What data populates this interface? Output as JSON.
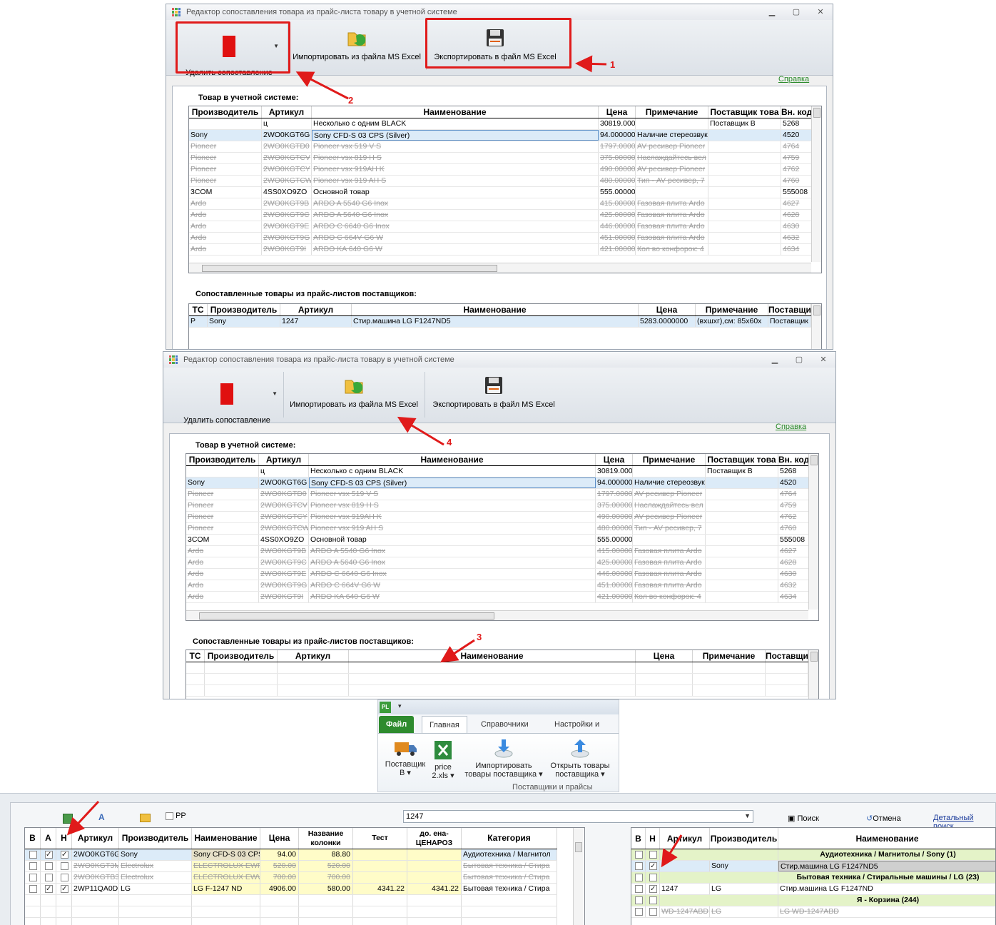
{
  "editor": {
    "title": "Редактор сопоставления товара из прайс-листа товару в учетной системе",
    "win_min": "▁",
    "win_max": "▢",
    "win_close": "✕",
    "delete_label": "Удалить сопоставление",
    "import_label": "Импортировать из файла MS Excel",
    "export_label": "Экспортировать в файл MS Excel",
    "help_label": "Справка",
    "accounting_label": "Товар в учетной системе:",
    "matched_label": "Сопоставленные товары из прайс-листов поставщиков:",
    "columns": [
      "Производитель",
      "Артикул",
      "Наименование",
      "Цена",
      "Примечание",
      "Поставщик това",
      "Вн. код"
    ],
    "rows": [
      {
        "maker": "",
        "sku": "ц",
        "name": "Несколько с одним BLACK",
        "price": "30819.000",
        "note": "",
        "supplier": "Поставщик В",
        "code": "5268",
        "state": "normal"
      },
      {
        "maker": "Sony",
        "sku": "2WO0KGT6G",
        "name": "Sony CFD-S 03 CPS (Silver)",
        "price": "94.000000",
        "note": "Наличие стереозвук",
        "supplier": "",
        "code": "4520",
        "state": "selected"
      },
      {
        "maker": "Pioneer",
        "sku": "2WO0KGTD0",
        "name": "Pioneer vsx 519 V S",
        "price": "1797.0000",
        "note": "AV ресивер Pioneer",
        "supplier": "",
        "code": "4764",
        "state": "deleted"
      },
      {
        "maker": "Pioneer",
        "sku": "2WO0KGTCV",
        "name": "Pioneer vsx 819 H S",
        "price": "375.00000",
        "note": "Наслаждайтесь вел",
        "supplier": "",
        "code": "4759",
        "state": "deleted"
      },
      {
        "maker": "Pioneer",
        "sku": "2WO0KGTCY",
        "name": "Pioneer vsx 919AH K",
        "price": "490.00000",
        "note": "AV ресивер Pioneer",
        "supplier": "",
        "code": "4762",
        "state": "deleted"
      },
      {
        "maker": "Pioneer",
        "sku": "2WO0KGTCW",
        "name": "Pioneer vsx 919 AH S",
        "price": "480.00000",
        "note": "Тип - AV ресивер, 7",
        "supplier": "",
        "code": "4760",
        "state": "deleted"
      },
      {
        "maker": "3COM",
        "sku": "4SS0XO9ZO",
        "name": "Основной товар",
        "price": "555.00000",
        "note": "",
        "supplier": "",
        "code": "555008",
        "state": "normal"
      },
      {
        "maker": "Ardo",
        "sku": "2WO0KGT9B",
        "name": "ARDO A 5540 G6 Inox",
        "price": "415.00000",
        "note": "Газовая плита Ardo",
        "supplier": "",
        "code": "4627",
        "state": "deleted"
      },
      {
        "maker": "Ardo",
        "sku": "2WO0KGT9C",
        "name": "ARDO A 5640 G6 Inox",
        "price": "425.00000",
        "note": "Газовая плита Ardo",
        "supplier": "",
        "code": "4628",
        "state": "deleted"
      },
      {
        "maker": "Ardo",
        "sku": "2WO0KGT9E",
        "name": "ARDO C 6640 G6 Inox",
        "price": "446.00000",
        "note": "Газовая плита Ardo",
        "supplier": "",
        "code": "4630",
        "state": "deleted"
      },
      {
        "maker": "Ardo",
        "sku": "2WO0KGT9G",
        "name": "ARDO C 664V G6 W",
        "price": "451.00000",
        "note": "Газовая плита Ardo",
        "supplier": "",
        "code": "4632",
        "state": "deleted"
      },
      {
        "maker": "Ardo",
        "sku": "2WO0KGT9I",
        "name": "ARDO KA 640 G6 W",
        "price": "421.00000",
        "note": "Кол во конфорок: 4",
        "supplier": "",
        "code": "4634",
        "state": "deleted"
      }
    ],
    "matched_columns": [
      "ТС",
      "Производитель",
      "Артикул",
      "Наименование",
      "Цена",
      "Примечание",
      "Поставщик"
    ],
    "matched_rows": [
      {
        "tc": "Р",
        "maker": "Sony",
        "sku": "1247",
        "name": "Стир.машина LG F1247ND5",
        "price": "5283.0000000",
        "note": "(вхшхг),см: 85х60х",
        "supplier": "Поставщик"
      }
    ]
  },
  "annotations": [
    "1",
    "2",
    "3",
    "4"
  ],
  "ribbon": {
    "qat_icon": "PL",
    "tabs": [
      "Файл",
      "Главная",
      "Справочники",
      "Настройки и опе"
    ],
    "buttons": [
      {
        "line1": "Поставщик",
        "line2": "В ▾",
        "icon": "truck-icon"
      },
      {
        "line1": "price",
        "line2": "2.xls ▾",
        "icon": "excel-icon"
      },
      {
        "line1": "Импортировать",
        "line2": "товары поставщика ▾",
        "icon": "import-icon"
      },
      {
        "line1": "Открыть товары",
        "line2": "поставщика ▾",
        "icon": "open-icon"
      }
    ],
    "group_label": "Поставщики и прайсы"
  },
  "matcher": {
    "pp_label": "PP",
    "search_value": "1247",
    "search_button": "Поиск",
    "cancel_button": "Отмена",
    "details_link": "Детальный поиск",
    "left_columns": [
      "В",
      "А",
      "Н",
      "Артикул",
      "Производитель",
      "Наименование",
      "Цена",
      "Название колонки",
      "Тест",
      "до. ена-ЦЕНАРОЗ",
      "Категория"
    ],
    "left_rows": [
      {
        "b": false,
        "a": true,
        "n": true,
        "sku": "2WO0KGT6G",
        "maker": "Sony",
        "name": "Sony CFD-S 03 CPS",
        "price": "94.00",
        "col": "88.80",
        "test": "",
        "retail": "",
        "cat": "Аудиотехника / Магнитол",
        "state": "selected"
      },
      {
        "b": false,
        "a": false,
        "n": false,
        "sku": "2WO0KGT3M",
        "maker": "Electrolux",
        "name": "ELECTROLUX EWFM",
        "price": "520.00",
        "col": "520.00",
        "test": "",
        "retail": "",
        "cat": "Бытовая техника / Стира",
        "state": "deleted"
      },
      {
        "b": false,
        "a": false,
        "n": false,
        "sku": "2WO0KGTB3",
        "maker": "Electrolux",
        "name": "ELECTROLUX EWW",
        "price": "700.00",
        "col": "700.00",
        "test": "",
        "retail": "",
        "cat": "Бытовая техника / Стира",
        "state": "deleted"
      },
      {
        "b": false,
        "a": true,
        "n": true,
        "sku": "2WP11QA0D",
        "maker": "LG",
        "name": "LG F-1247 ND",
        "price": "4906.00",
        "col": "580.00",
        "test": "4341.22",
        "retail": "4341.22",
        "cat": "Бытовая техника / Стира",
        "state": "normal"
      }
    ],
    "right_columns": [
      "В",
      "Н",
      "Артикул",
      "Производитель",
      "Наименование"
    ],
    "right_rows": [
      {
        "type": "group",
        "title": "Аудиотехника / Магнитолы / Sony (1)"
      },
      {
        "type": "item",
        "b": false,
        "n": true,
        "sku": "",
        "maker": "Sony",
        "name": "Стир.машина LG F1247ND5",
        "state": "selected"
      },
      {
        "type": "group",
        "title": "Бытовая техника / Стиральные машины / LG (23)"
      },
      {
        "type": "item",
        "b": false,
        "n": true,
        "sku": "1247",
        "maker": "LG",
        "name": "Стир.машина LG F1247ND",
        "state": "normal"
      },
      {
        "type": "group",
        "title": "Я - Корзина (244)"
      },
      {
        "type": "item",
        "b": false,
        "n": false,
        "sku": "WD-1247ABD",
        "maker": "LG",
        "name": "LG WD-1247ABD",
        "state": "deleted"
      }
    ]
  }
}
